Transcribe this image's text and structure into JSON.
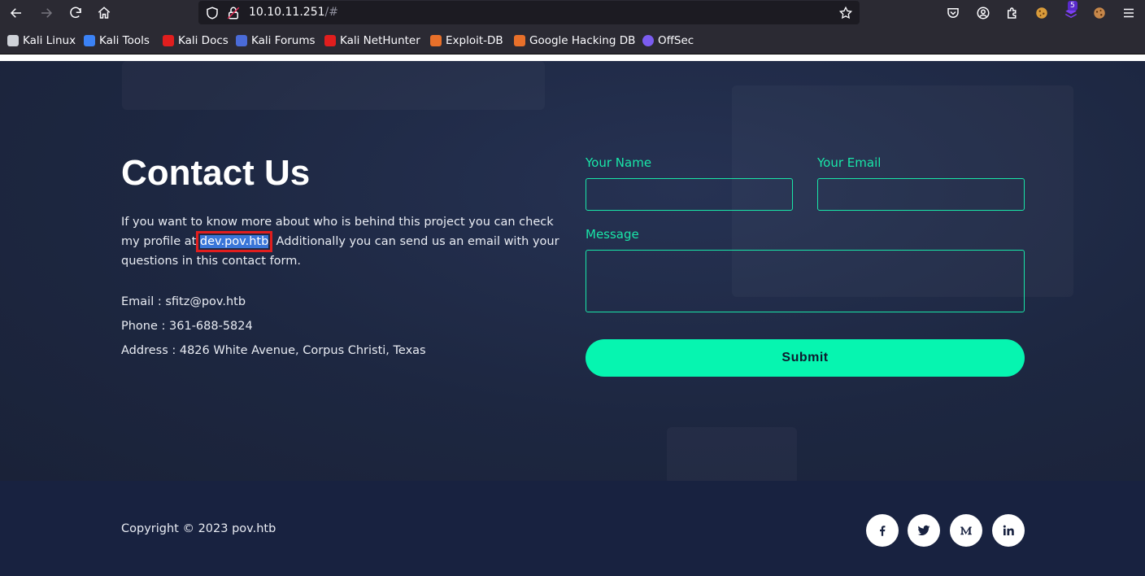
{
  "browser": {
    "url_host": "10.10.11.251",
    "url_path": "/#",
    "extensions_badge": "5",
    "bookmarks": [
      {
        "label": "Kali Linux",
        "icon": "kali-dragon-icon",
        "color": "#cfd2d8"
      },
      {
        "label": "Kali Tools",
        "icon": "kali-tools-icon",
        "color": "#3b82f6"
      },
      {
        "label": "Kali Docs",
        "icon": "kali-docs-icon",
        "color": "#e11e1e"
      },
      {
        "label": "Kali Forums",
        "icon": "kali-forums-icon",
        "color": "#4a6bd8"
      },
      {
        "label": "Kali NetHunter",
        "icon": "nethunter-icon",
        "color": "#e11e1e"
      },
      {
        "label": "Exploit-DB",
        "icon": "exploit-db-icon",
        "color": "#e8702a"
      },
      {
        "label": "Google Hacking DB",
        "icon": "ghdb-icon",
        "color": "#e8702a"
      },
      {
        "label": "OffSec",
        "icon": "offsec-icon",
        "color": "#7b5cf0"
      }
    ]
  },
  "contact": {
    "title": "Contact Us",
    "intro_before": "If you want to know more about who is behind this project you can check my profile at ",
    "intro_link": "dev.pov.htb",
    "intro_after": ". Additionally you can send us an email with your questions in this contact form.",
    "email": "Email : sfitz@pov.htb",
    "phone": "Phone : 361-688-5824",
    "address": "Address : 4826 White Avenue, Corpus Christi, Texas"
  },
  "form": {
    "name_label": "Your Name",
    "email_label": "Your Email",
    "message_label": "Message",
    "submit_label": "Submit",
    "accent_color": "#19e6a8"
  },
  "footer": {
    "copyright": "Copyright © 2023 pov.htb",
    "social": [
      "facebook-icon",
      "twitter-icon",
      "medium-icon",
      "linkedin-icon"
    ]
  }
}
